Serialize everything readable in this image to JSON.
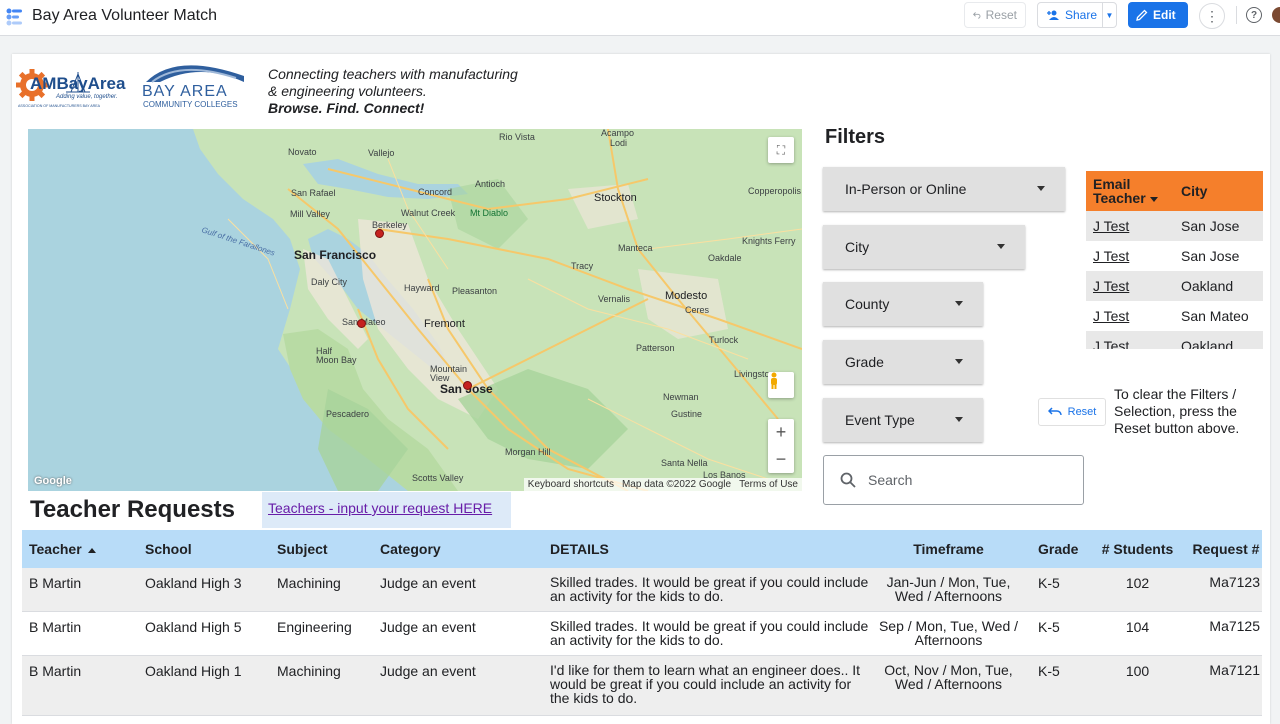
{
  "header": {
    "title": "Bay Area Volunteer Match",
    "reset_label": "Reset",
    "share_label": "Share",
    "edit_label": "Edit",
    "help_label": "?"
  },
  "logos": {
    "am_name": "AMBayArea",
    "am_slogan": "Adding value, together.",
    "am_sub": "ASSOCIATION OF MANUFACTURERS BAY AREA",
    "bay_name": "BAY AREA",
    "bay_sub": "COMMUNITY COLLEGES"
  },
  "tagline": {
    "line1": "Connecting teachers with manufacturing",
    "line2": "& engineering volunteers.",
    "line3": "Browse. Find. Connect!"
  },
  "map": {
    "labels": {
      "san_francisco": "San Francisco",
      "san_jose": "San Jose",
      "fremont": "Fremont",
      "stockton": "Stockton",
      "modesto": "Modesto",
      "berkeley": "Berkeley",
      "novato": "Novato",
      "vallejo": "Vallejo",
      "rio_vista": "Rio Vista",
      "acampo": "Acampo",
      "lodi": "Lodi",
      "san_rafael": "San Rafael",
      "concord": "Concord",
      "antioch": "Antioch",
      "mill_valley": "Mill Valley",
      "walnut_creek": "Walnut Creek",
      "mt_diablo": "Mt Diablo",
      "copperopolis": "Copperopolis",
      "knights_ferry": "Knights Ferry",
      "manteca": "Manteca",
      "oakdale": "Oakdale",
      "tracy": "Tracy",
      "daly_city": "Daly City",
      "hayward": "Hayward",
      "pleasanton": "Pleasanton",
      "vernalis": "Vernalis",
      "ceres": "Ceres",
      "san_mateo": "San Mateo",
      "half_moon_bay": "Half\nMoon Bay",
      "turlock": "Turlock",
      "patterson": "Patterson",
      "mountain_view": "Mountain\nView",
      "livingston": "Livingston",
      "newman": "Newman",
      "gustine": "Gustine",
      "pescadero": "Pescadero",
      "morgan_hill": "Morgan Hill",
      "santa_nella": "Santa Nella",
      "los_banos": "Los Banos",
      "scotts_valley": "Scotts Valley",
      "farallones": "Gulf of the Farallones"
    },
    "google": "Google",
    "attrib_shortcuts": "Keyboard shortcuts",
    "attrib_data": "Map data ©2022 Google",
    "attrib_terms": "Terms of Use"
  },
  "filters": {
    "title": "Filters",
    "dropdowns": [
      "In-Person or Online",
      "City",
      "County",
      "Grade",
      "Event Type"
    ],
    "search_placeholder": "Search",
    "reset_label": "Reset",
    "reset_note": "To clear the Filters / Selection, press the Reset button above."
  },
  "email_table": {
    "col1": "Email Teacher",
    "col2": "City",
    "rows": [
      {
        "teacher": "J Test",
        "city": "San Jose"
      },
      {
        "teacher": "J Test",
        "city": "San Jose"
      },
      {
        "teacher": "J Test",
        "city": "Oakland"
      },
      {
        "teacher": "J Test",
        "city": "San Mateo"
      },
      {
        "teacher": "J Test",
        "city": "Oakland"
      }
    ]
  },
  "requests": {
    "title": "Teacher Requests",
    "link": "Teachers - input your request HERE",
    "columns": [
      "Teacher",
      "School",
      "Subject",
      "Category",
      "DETAILS",
      "Timeframe",
      "Grade",
      "# Students",
      "Request #"
    ],
    "rows": [
      {
        "teacher": "B Martin",
        "school": "Oakland High 3",
        "subject": "Machining",
        "category": "Judge an event",
        "details": "Skilled trades. It would be great if you could include an activity for the kids to do.",
        "timeframe": "Jan-Jun / Mon, Tue, Wed / Afternoons",
        "grade": "K-5",
        "students": "102",
        "request": "Ma7123"
      },
      {
        "teacher": "B Martin",
        "school": "Oakland High 5",
        "subject": "Engineering",
        "category": "Judge an event",
        "details": "Skilled trades. It would be great if you could include an activity for the kids to do.",
        "timeframe": "Sep / Mon, Tue, Wed / Afternoons",
        "grade": "K-5",
        "students": "104",
        "request": "Ma7125"
      },
      {
        "teacher": "B Martin",
        "school": "Oakland High 1",
        "subject": "Machining",
        "category": "Judge an event",
        "details": "I'd like for them to learn what an engineer does.. It would be great if you could include an activity for the kids to do.",
        "timeframe": "Oct, Nov / Mon, Tue, Wed / Afternoons",
        "grade": "K-5",
        "students": "100",
        "request": "Ma7121"
      }
    ]
  }
}
